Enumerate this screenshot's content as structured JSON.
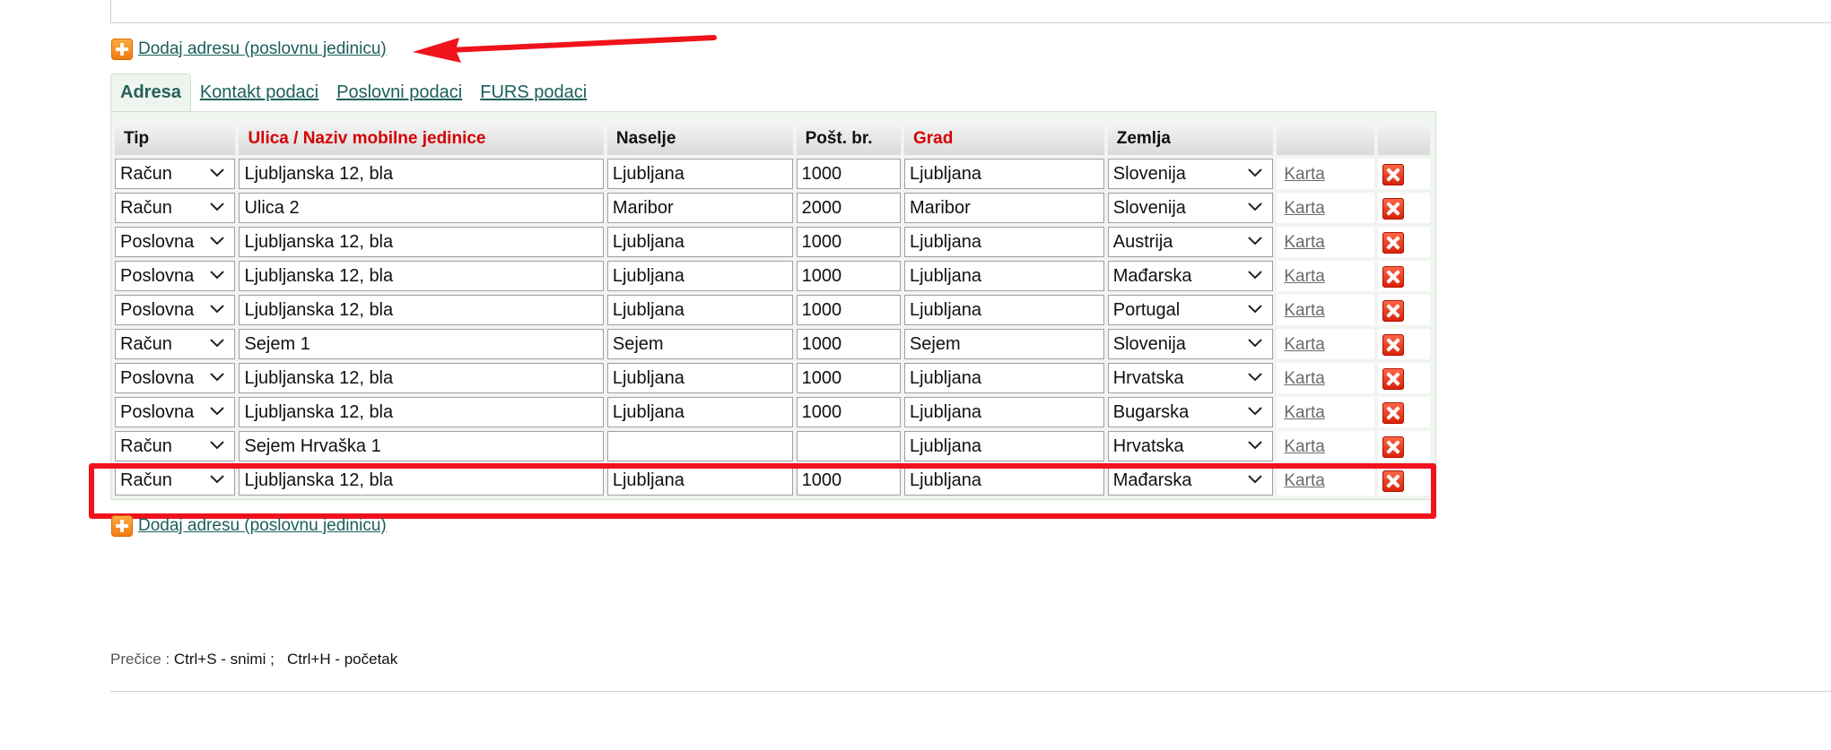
{
  "add_address": {
    "label": "Dodaj adresu (poslovnu jedinicu)",
    "icon": "plus-icon"
  },
  "tabs": [
    {
      "label": "Adresa",
      "active": true
    },
    {
      "label": "Kontakt podaci",
      "active": false
    },
    {
      "label": "Poslovni podaci",
      "active": false
    },
    {
      "label": "FURS podaci",
      "active": false
    }
  ],
  "table": {
    "headers": {
      "tip": "Tip",
      "ulica": "Ulica / Naziv mobilne jedinice",
      "naselje": "Naselje",
      "post_br": "Pošt. br.",
      "grad": "Grad",
      "zemlja": "Zemlja"
    },
    "map_link_label": "Karta",
    "delete_icon": "delete-icon",
    "rows": [
      {
        "tip": "Račun",
        "ulica": "Ljubljanska 12, bla",
        "naselje": "Ljubljana",
        "post_br": "1000",
        "grad": "Ljubljana",
        "zemlja": "Slovenija"
      },
      {
        "tip": "Račun",
        "ulica": "Ulica 2",
        "naselje": "Maribor",
        "post_br": "2000",
        "grad": "Maribor",
        "zemlja": "Slovenija"
      },
      {
        "tip": "Poslovna",
        "ulica": "Ljubljanska 12, bla",
        "naselje": "Ljubljana",
        "post_br": "1000",
        "grad": "Ljubljana",
        "zemlja": "Austrija"
      },
      {
        "tip": "Poslovna",
        "ulica": "Ljubljanska 12, bla",
        "naselje": "Ljubljana",
        "post_br": "1000",
        "grad": "Ljubljana",
        "zemlja": "Mađarska"
      },
      {
        "tip": "Poslovna",
        "ulica": "Ljubljanska 12, bla",
        "naselje": "Ljubljana",
        "post_br": "1000",
        "grad": "Ljubljana",
        "zemlja": "Portugal"
      },
      {
        "tip": "Račun",
        "ulica": "Sejem 1",
        "naselje": "Sejem",
        "post_br": "1000",
        "grad": "Sejem",
        "zemlja": "Slovenija"
      },
      {
        "tip": "Poslovna",
        "ulica": "Ljubljanska 12, bla",
        "naselje": "Ljubljana",
        "post_br": "1000",
        "grad": "Ljubljana",
        "zemlja": "Hrvatska"
      },
      {
        "tip": "Poslovna",
        "ulica": "Ljubljanska 12, bla",
        "naselje": "Ljubljana",
        "post_br": "1000",
        "grad": "Ljubljana",
        "zemlja": "Bugarska"
      },
      {
        "tip": "Račun",
        "ulica": "Sejem Hrvaška 1",
        "naselje": "",
        "post_br": "",
        "grad": "Ljubljana",
        "zemlja": "Hrvatska"
      },
      {
        "tip": "Račun",
        "ulica": "Ljubljanska 12, bla",
        "naselje": "Ljubljana",
        "post_br": "1000",
        "grad": "Ljubljana",
        "zemlja": "Mađarska"
      }
    ]
  },
  "shortcuts": {
    "label": "Prečice : ",
    "items": [
      "Ctrl+S - snimi ;",
      "Ctrl+H - početak"
    ]
  },
  "colors": {
    "link": "#1a5f5a",
    "required_header": "#d40000",
    "annotation_red": "#f0131b",
    "table_bg": "#f0f5ef"
  }
}
